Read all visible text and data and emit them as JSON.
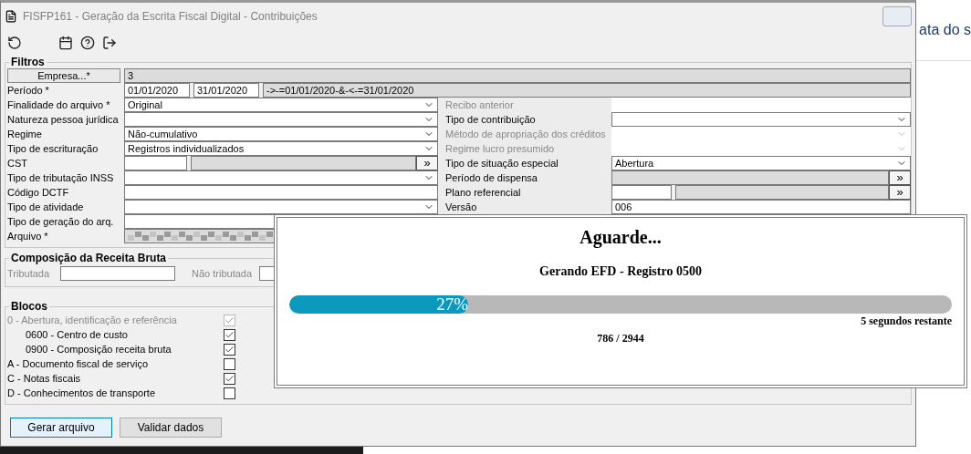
{
  "window": {
    "title": "FISFP161 - Geração da Escrita Fiscal Digital - Contribuições"
  },
  "filtros": {
    "title": "Filtros",
    "empresa": {
      "button": "Empresa...*",
      "value": "3"
    },
    "periodo": {
      "label": "Período *",
      "start": "01/01/2020",
      "end": "31/01/2020",
      "expression": "->-=01/01/2020-&-<-=31/01/2020"
    },
    "left_rows": [
      {
        "label": "Finalidade do arquivo *",
        "kind": "select",
        "value": "Original"
      },
      {
        "label": "Natureza pessoa jurídica",
        "kind": "select"
      },
      {
        "label": "Regime",
        "kind": "select",
        "value": "Não-cumulativo"
      },
      {
        "label": "Tipo de escrituração",
        "kind": "select",
        "value": "Registros individualizados"
      },
      {
        "label": "CST",
        "kind": "lookup",
        "button": "»"
      },
      {
        "label": "Tipo de tributação INSS",
        "kind": "select"
      },
      {
        "label": "Código DCTF",
        "kind": "input"
      },
      {
        "label": "Tipo de atividade",
        "kind": "select"
      },
      {
        "label": "Tipo de geração do arq.",
        "kind": "input"
      },
      {
        "label": "Arquivo *",
        "kind": "blurred"
      }
    ],
    "right_rows": [
      {
        "label": "Recibo anterior",
        "kind": "input",
        "disabled": true
      },
      {
        "label": "Tipo de contribuição",
        "kind": "select",
        "disabled": false
      },
      {
        "label": "Método de apropriação dos créditos",
        "kind": "select",
        "disabled": true
      },
      {
        "label": "Regime lucro presumido",
        "kind": "select",
        "disabled": true
      },
      {
        "label": "Tipo de situação especial",
        "kind": "select",
        "disabled": false,
        "value": "Abertura"
      },
      {
        "label": "Período de dispensa",
        "kind": "readonly-lookup",
        "disabled": false,
        "button": "»"
      },
      {
        "label": "Plano referencial",
        "kind": "lookup",
        "disabled": false,
        "button": "»"
      },
      {
        "label": "Versão",
        "kind": "input",
        "disabled": false,
        "value": "006"
      }
    ]
  },
  "composicao": {
    "title": "Composição da Receita Bruta",
    "fields": [
      {
        "label": "Tributada"
      },
      {
        "label": "Não tributada"
      }
    ]
  },
  "blocos": {
    "title": "Blocos",
    "items": [
      {
        "label": "0 - Abertura, identificação e referência",
        "checked": true,
        "disabled": true,
        "children": [
          {
            "label": "0600 - Centro de custo",
            "checked": true,
            "disabled": false
          },
          {
            "label": "0900 - Composição receita bruta",
            "checked": true,
            "disabled": false
          }
        ]
      },
      {
        "label": "A - Documento fiscal de serviço",
        "checked": false,
        "disabled": false
      },
      {
        "label": "C - Notas fiscais",
        "checked": true,
        "disabled": false
      },
      {
        "label": "D - Conhecimentos de transporte",
        "checked": false,
        "disabled": false
      }
    ]
  },
  "buttons": [
    {
      "label": "Gerar arquivo",
      "selected": true
    },
    {
      "label": "Validar dados",
      "selected": false
    }
  ],
  "background_text": "ata do s",
  "dialog": {
    "title": "Aguarde...",
    "message": "Gerando EFD - Registro 0500",
    "progress": {
      "level": 0.27,
      "label": "27%"
    },
    "remaining": "5 segundos restante",
    "count": "786 / 2944"
  }
}
